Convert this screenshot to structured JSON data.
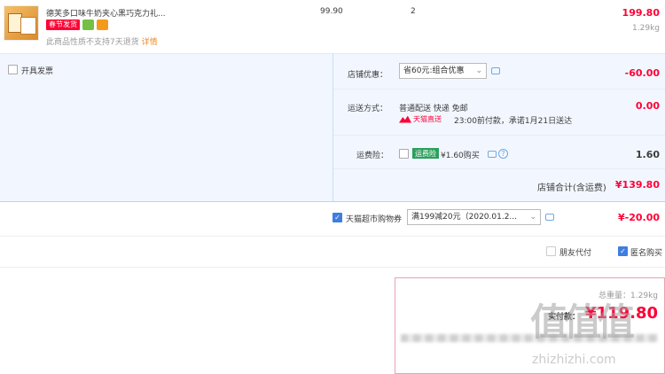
{
  "item": {
    "title": "德芙多口味牛奶夹心黑巧克力礼...",
    "tag": "春节发货",
    "notice": "此商品性质不支持7天退货",
    "notice_link": "详情",
    "unit_price": "99.90",
    "quantity": "2",
    "subtotal": "199.80",
    "weight": "1.29kg"
  },
  "invoice": {
    "label": "开具发票"
  },
  "shop_discount": {
    "label": "店铺优惠：",
    "selected": "省60元:组合优惠",
    "amount": "-60.00"
  },
  "shipping": {
    "label": "运送方式：",
    "method": "普通配送 快递 免邮",
    "badge": "天猫直送",
    "eta": "23:00前付款，承诺1月21日送达",
    "amount": "0.00"
  },
  "insurance": {
    "label": "运费险：",
    "badge": "运费险",
    "price_text": "¥1.60购买",
    "amount": "1.60"
  },
  "shop_total": {
    "label": "店铺合计(含运费)",
    "amount": "¥139.80"
  },
  "coupon": {
    "label": "天猫超市购物券",
    "selected": "满199减20元（2020.01.2...",
    "amount": "¥-20.00"
  },
  "options": {
    "friend_pay": "朋友代付",
    "anonymous": "匿名购买"
  },
  "summary": {
    "weight_text": "总重量：1.29kg",
    "pay_label": "实付款：",
    "pay_amount": "¥119.80"
  },
  "watermark": {
    "chars": "值值值",
    "domain": "zhizhizhi.com"
  },
  "colors": {
    "accent_red": "#ff0036",
    "link_blue": "#3d7ee0",
    "panel_bg": "#f2f7ff"
  }
}
